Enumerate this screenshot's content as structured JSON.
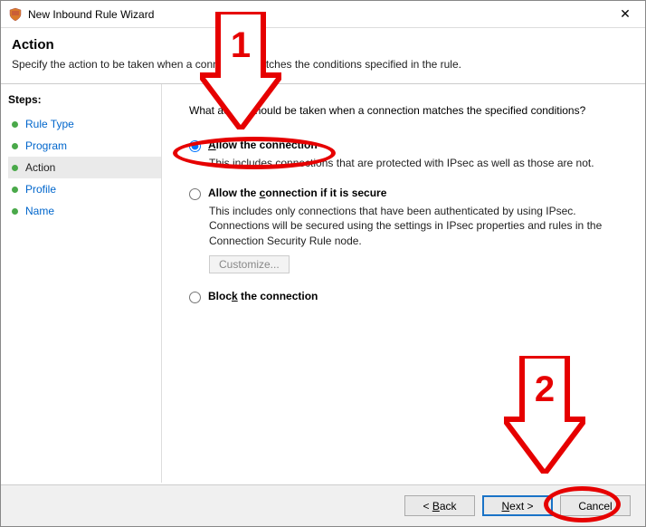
{
  "window": {
    "title": "New Inbound Rule Wizard"
  },
  "header": {
    "title": "Action",
    "subtitle": "Specify the action to be taken when a connection matches the conditions specified in the rule."
  },
  "steps": {
    "title": "Steps:",
    "items": [
      {
        "label": "Rule Type",
        "active": false
      },
      {
        "label": "Program",
        "active": false
      },
      {
        "label": "Action",
        "active": true
      },
      {
        "label": "Profile",
        "active": false
      },
      {
        "label": "Name",
        "active": false
      }
    ]
  },
  "main": {
    "prompt": "What action should be taken when a connection matches the specified conditions?",
    "options": [
      {
        "id": "allow",
        "label": "Allow the connection",
        "accesskey": "A",
        "desc": "This includes connections that are protected with IPsec as well as those are not.",
        "checked": true
      },
      {
        "id": "allow-secure",
        "label": "Allow the connection if it is secure",
        "accesskey": "c",
        "desc": "This includes only connections that have been authenticated by using IPsec.  Connections will be secured using the settings in IPsec properties and rules in the Connection Security Rule node.",
        "customize": "Customize...",
        "checked": false
      },
      {
        "id": "block",
        "label": "Block the connection",
        "accesskey": "K",
        "checked": false
      }
    ]
  },
  "footer": {
    "back": "< Back",
    "next": "Next >",
    "cancel": "Cancel"
  },
  "annotations": {
    "num1": "1",
    "num2": "2"
  }
}
